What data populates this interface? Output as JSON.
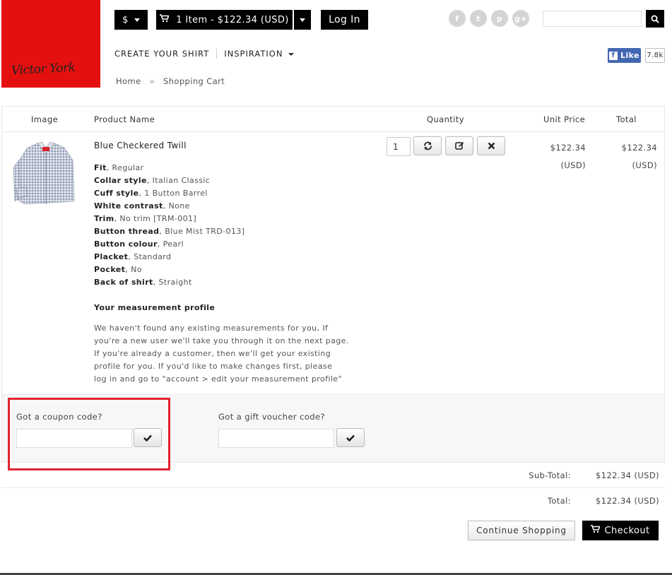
{
  "brand": {
    "logo_text": "Victor York",
    "accent": "#e4100f"
  },
  "header": {
    "currency": "$",
    "cart": "1 Item - $122.34 (USD)",
    "login": "Log In",
    "social": [
      "f",
      "t",
      "p",
      "g+"
    ],
    "fb_like": "Like",
    "fb_count": "7.8k"
  },
  "nav": {
    "create": "CREATE YOUR SHIRT",
    "inspiration": "INSPIRATION"
  },
  "breadcrumb": {
    "home": "Home",
    "sep": "»",
    "current": "Shopping Cart"
  },
  "table": {
    "headers": {
      "image": "Image",
      "name": "Product Name",
      "qty": "Quantity",
      "unit": "Unit Price",
      "total": "Total"
    },
    "item": {
      "name": "Blue Checkered Twill",
      "qty": "1",
      "unit_price": "$122.34",
      "unit_currency": "(USD)",
      "total": "$122.34",
      "total_currency": "(USD)",
      "options": [
        {
          "k": "Fit",
          "v": ", Regular"
        },
        {
          "k": "Collar style",
          "v": ", Italian Classic"
        },
        {
          "k": "Cuff style",
          "v": ", 1 Button Barrel"
        },
        {
          "k": "White contrast",
          "v": ", None"
        },
        {
          "k": "Trim",
          "v": ", No trim [TRM-001]"
        },
        {
          "k": "Button thread",
          "v": ", Blue Mist TRD-013]"
        },
        {
          "k": "Button colour",
          "v": ", Pearl"
        },
        {
          "k": "Placket",
          "v": ", Standard"
        },
        {
          "k": "Pocket",
          "v": ", No"
        },
        {
          "k": "Back of shirt",
          "v": ", Straight"
        }
      ],
      "measure_title": "Your measurement profile",
      "measure_lines": [
        "We haven't found any existing measurements for you, If",
        "you're a new user we'll take you through it on the next page.",
        "If you're already a customer, then we'll get your existing",
        "profile for you. If you'd like to make changes first, please",
        "log in and go to \"account > edit your measurement profile\""
      ]
    }
  },
  "coupon": {
    "label": "Got a coupon code?",
    "value": ""
  },
  "voucher": {
    "label": "Got a gift voucher code?",
    "value": ""
  },
  "totals": {
    "subtotal_label": "Sub-Total:",
    "subtotal": "$122.34 (USD)",
    "total_label": "Total:",
    "total": "$122.34 (USD)"
  },
  "actions": {
    "continue": "Continue Shopping",
    "checkout": "Checkout"
  }
}
